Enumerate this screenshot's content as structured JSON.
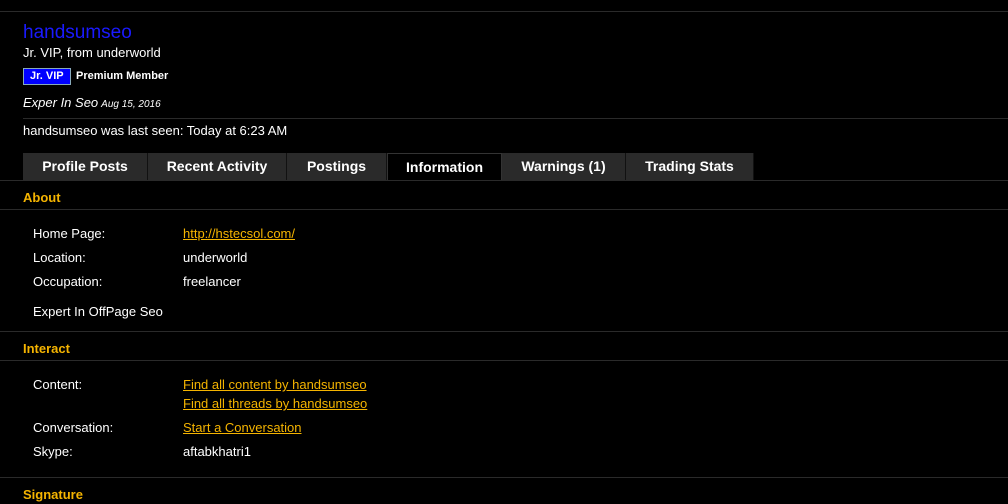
{
  "profile": {
    "username": "handsumseo",
    "title": "Jr. VIP, from underworld",
    "badge": "Jr. VIP",
    "membership": "Premium Member",
    "status_text": "Exper In Seo",
    "status_date": "Aug 15, 2016",
    "last_seen": "handsumseo was last seen: Today at 6:23 AM"
  },
  "tabs": [
    {
      "label": "Profile Posts"
    },
    {
      "label": "Recent Activity"
    },
    {
      "label": "Postings"
    },
    {
      "label": "Information",
      "active": true
    },
    {
      "label": "Warnings (1)"
    },
    {
      "label": "Trading Stats"
    }
  ],
  "about": {
    "heading": "About",
    "homepage_label": "Home Page:",
    "homepage_value": "http://hstecsol.com/",
    "location_label": "Location:",
    "location_value": "underworld",
    "occupation_label": "Occupation:",
    "occupation_value": "freelancer",
    "bio": "Expert In OffPage Seo"
  },
  "interact": {
    "heading": "Interact",
    "content_label": "Content:",
    "content_link1": "Find all content by handsumseo",
    "content_link2": "Find all threads by handsumseo",
    "conversation_label": "Conversation:",
    "conversation_link": "Start a Conversation",
    "skype_label": "Skype:",
    "skype_value": "aftabkhatri1"
  },
  "signature": {
    "heading": "Signature"
  },
  "colors": {
    "background": "#000000",
    "accent": "#f5b400",
    "username": "#1a1aff",
    "badge": "#0000ff"
  }
}
